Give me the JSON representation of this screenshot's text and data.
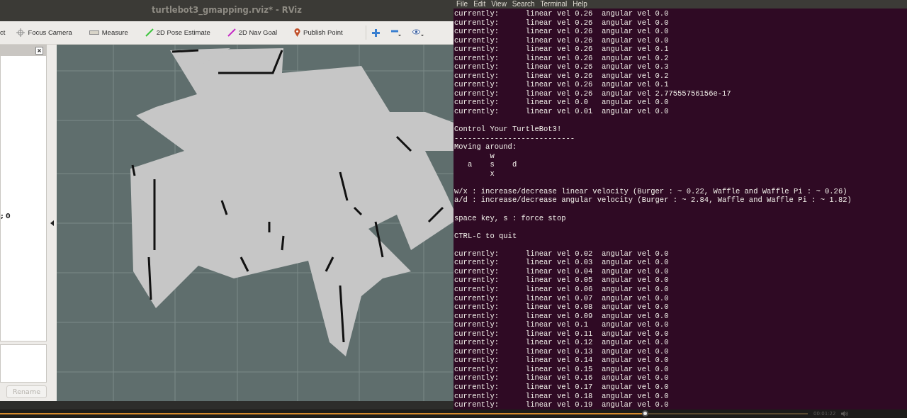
{
  "rviz": {
    "title": "turtlebot3_gmapping.rviz* - RViz",
    "tools": [
      {
        "label": "ct",
        "kind": "plain"
      },
      {
        "label": "Focus Camera",
        "kind": "focus"
      },
      {
        "label": "Measure",
        "kind": "measure"
      },
      {
        "label": "2D Pose Estimate",
        "kind": "pose"
      },
      {
        "label": "2D Nav Goal",
        "kind": "goal"
      },
      {
        "label": "Publish Point",
        "kind": "point"
      }
    ],
    "panel_text": "; 0",
    "rename_button": {
      "label": "Rename",
      "disabled": true
    }
  },
  "terminal": {
    "menu": [
      "File",
      "Edit",
      "View",
      "Search",
      "Terminal",
      "Help"
    ],
    "blocks": [
      [
        "currently:\tlinear vel 0.26\t angular vel 0.0",
        "currently:\tlinear vel 0.26\t angular vel 0.0",
        "currently:\tlinear vel 0.26\t angular vel 0.0",
        "currently:\tlinear vel 0.26\t angular vel 0.0",
        "currently:\tlinear vel 0.26\t angular vel 0.1",
        "currently:\tlinear vel 0.26\t angular vel 0.2",
        "currently:\tlinear vel 0.26\t angular vel 0.3",
        "currently:\tlinear vel 0.26\t angular vel 0.2",
        "currently:\tlinear vel 0.26\t angular vel 0.1",
        "currently:\tlinear vel 0.26\t angular vel 2.77555756156e-17",
        "currently:\tlinear vel 0.0\t angular vel 0.0",
        "currently:\tlinear vel 0.01\t angular vel 0.0"
      ],
      [
        "Control Your TurtleBot3!",
        "---------------------------",
        "Moving around:",
        "        w",
        "   a    s    d",
        "        x"
      ],
      [
        "w/x : increase/decrease linear velocity (Burger : ~ 0.22, Waffle and Waffle Pi : ~ 0.26)",
        "a/d : increase/decrease angular velocity (Burger : ~ 2.84, Waffle and Waffle Pi : ~ 1.82)"
      ],
      [
        "space key, s : force stop"
      ],
      [
        "CTRL-C to quit"
      ],
      [
        "currently:\tlinear vel 0.02\t angular vel 0.0",
        "currently:\tlinear vel 0.03\t angular vel 0.0",
        "currently:\tlinear vel 0.04\t angular vel 0.0",
        "currently:\tlinear vel 0.05\t angular vel 0.0",
        "currently:\tlinear vel 0.06\t angular vel 0.0",
        "currently:\tlinear vel 0.07\t angular vel 0.0",
        "currently:\tlinear vel 0.08\t angular vel 0.0",
        "currently:\tlinear vel 0.09\t angular vel 0.0",
        "currently:\tlinear vel 0.1\t angular vel 0.0",
        "currently:\tlinear vel 0.11\t angular vel 0.0",
        "currently:\tlinear vel 0.12\t angular vel 0.0",
        "currently:\tlinear vel 0.13\t angular vel 0.0",
        "currently:\tlinear vel 0.14\t angular vel 0.0",
        "currently:\tlinear vel 0.15\t angular vel 0.0",
        "currently:\tlinear vel 0.16\t angular vel 0.0",
        "currently:\tlinear vel 0.17\t angular vel 0.0",
        "currently:\tlinear vel 0.18\t angular vel 0.0",
        "currently:\tlinear vel 0.19\t angular vel 0.0"
      ]
    ]
  },
  "video": {
    "time": "00:01:22",
    "level": 0.8
  }
}
